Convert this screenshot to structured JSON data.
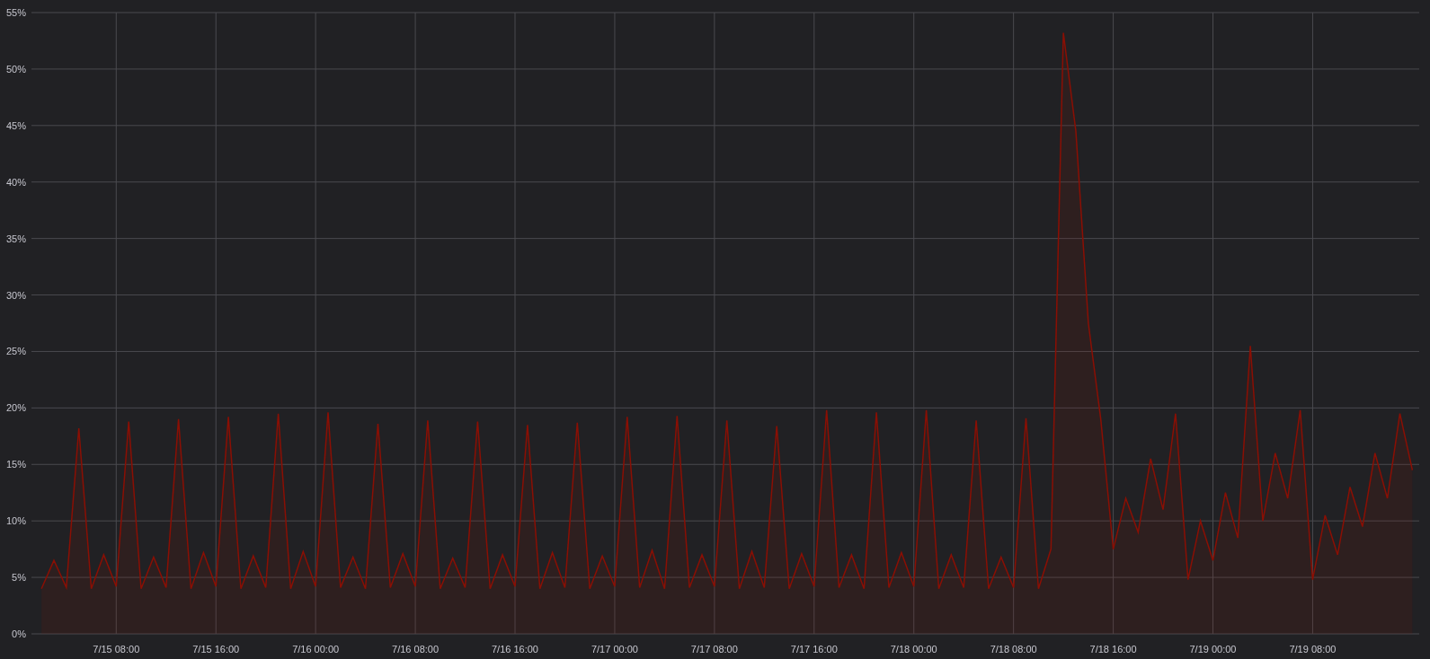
{
  "chart_data": {
    "type": "area",
    "grid": true,
    "ylim": [
      0,
      55
    ],
    "yticks": [
      {
        "value": 0,
        "label": "0%"
      },
      {
        "value": 5,
        "label": "5%"
      },
      {
        "value": 10,
        "label": "10%"
      },
      {
        "value": 15,
        "label": "15%"
      },
      {
        "value": 20,
        "label": "20%"
      },
      {
        "value": 25,
        "label": "25%"
      },
      {
        "value": 30,
        "label": "30%"
      },
      {
        "value": 35,
        "label": "35%"
      },
      {
        "value": 40,
        "label": "40%"
      },
      {
        "value": 45,
        "label": "45%"
      },
      {
        "value": 50,
        "label": "50%"
      },
      {
        "value": 55,
        "label": "55%"
      }
    ],
    "categories": [
      null,
      null,
      null,
      null,
      null,
      null,
      "7/15 08:00",
      null,
      null,
      null,
      null,
      null,
      null,
      null,
      "7/15 16:00",
      null,
      null,
      null,
      null,
      null,
      null,
      null,
      "7/16 00:00",
      null,
      null,
      null,
      null,
      null,
      null,
      null,
      "7/16 08:00",
      null,
      null,
      null,
      null,
      null,
      null,
      null,
      "7/16 16:00",
      null,
      null,
      null,
      null,
      null,
      null,
      null,
      "7/17 00:00",
      null,
      null,
      null,
      null,
      null,
      null,
      null,
      "7/17 08:00",
      null,
      null,
      null,
      null,
      null,
      null,
      null,
      "7/17 16:00",
      null,
      null,
      null,
      null,
      null,
      null,
      null,
      "7/18 00:00",
      null,
      null,
      null,
      null,
      null,
      null,
      null,
      "7/18 08:00",
      null,
      null,
      null,
      null,
      null,
      null,
      null,
      "7/18 16:00",
      null,
      null,
      null,
      null,
      null,
      null,
      null,
      "7/19 00:00",
      null,
      null,
      null,
      null,
      null,
      null,
      null,
      "7/19 08:00",
      null,
      null,
      null,
      null,
      null,
      null,
      null,
      null
    ],
    "series": [
      {
        "color": "#8a0f04",
        "values": [
          4.0,
          6.5,
          4.1,
          18.2,
          4.0,
          7.0,
          4.2,
          18.8,
          4.0,
          6.8,
          4.1,
          19.0,
          4.0,
          7.2,
          4.2,
          19.2,
          4.0,
          6.9,
          4.1,
          19.5,
          4.0,
          7.3,
          4.2,
          19.6,
          4.1,
          6.8,
          4.0,
          18.6,
          4.1,
          7.1,
          4.2,
          18.9,
          4.0,
          6.7,
          4.1,
          18.8,
          4.0,
          7.0,
          4.2,
          18.5,
          4.0,
          7.2,
          4.1,
          18.7,
          4.0,
          6.9,
          4.2,
          19.2,
          4.1,
          7.4,
          4.0,
          19.3,
          4.1,
          7.0,
          4.2,
          18.9,
          4.0,
          7.3,
          4.1,
          18.4,
          4.0,
          7.1,
          4.2,
          19.8,
          4.1,
          7.0,
          4.0,
          19.6,
          4.1,
          7.2,
          4.2,
          19.8,
          4.0,
          7.0,
          4.1,
          18.9,
          4.0,
          6.8,
          4.1,
          19.1,
          4.0,
          7.5,
          53.2,
          44.5,
          27.5,
          19.0,
          7.5,
          12.0,
          9.0,
          15.5,
          11.0,
          19.5,
          4.8,
          10.0,
          6.5,
          12.5,
          8.5,
          25.5,
          10.0,
          16.0,
          12.0,
          19.8,
          4.8,
          10.5,
          7.0,
          13.0,
          9.5,
          16.0,
          12.0,
          19.5,
          14.5
        ]
      }
    ]
  }
}
